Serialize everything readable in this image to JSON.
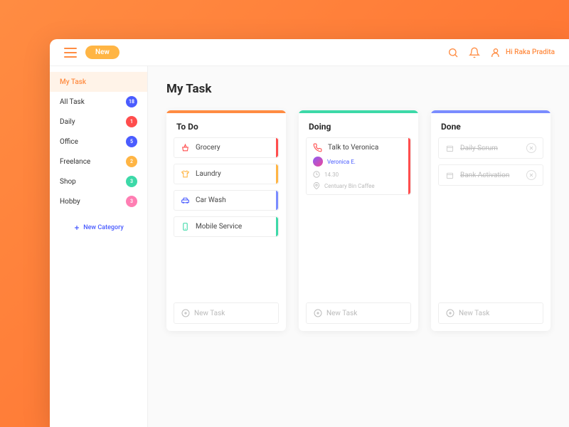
{
  "topbar": {
    "newLabel": "New",
    "greeting": "Hi Raka Pradita"
  },
  "sidebar": {
    "items": [
      {
        "label": "My Task",
        "active": true
      },
      {
        "label": "All Task",
        "badge": "18",
        "color": "#4a5cff"
      },
      {
        "label": "Daily",
        "badge": "1",
        "color": "#ff4d4d"
      },
      {
        "label": "Office",
        "badge": "5",
        "color": "#4a5cff"
      },
      {
        "label": "Freelance",
        "badge": "2",
        "color": "#ffb544"
      },
      {
        "label": "Shop",
        "badge": "3",
        "color": "#3dd9a8"
      },
      {
        "label": "Hobby",
        "badge": "3",
        "color": "#ff7eb3"
      }
    ],
    "newCategory": "New Category"
  },
  "page": {
    "title": "My Task"
  },
  "columns": {
    "todo": {
      "title": "To Do",
      "barColor": "#ff8c42",
      "tasks": [
        {
          "label": "Grocery",
          "iconColor": "#ff4d4d",
          "stripe": "#ff4d4d"
        },
        {
          "label": "Laundry",
          "iconColor": "#ffb544",
          "stripe": "#ffb544"
        },
        {
          "label": "Car Wash",
          "iconColor": "#4a5cff",
          "stripe": "#7a8cff"
        },
        {
          "label": "Mobile Service",
          "iconColor": "#3dd9a8",
          "stripe": "#3dd9a8"
        }
      ],
      "newTask": "New Task"
    },
    "doing": {
      "title": "Doing",
      "barColor": "#3dd9a8",
      "task": {
        "label": "Talk to Veronica",
        "iconColor": "#ff4d4d",
        "stripe": "#ff4d4d",
        "person": "Veronica E.",
        "time": "14.30",
        "place": "Centuary Bin Caffee"
      },
      "newTask": "New Task"
    },
    "done": {
      "title": "Done",
      "barColor": "#7a8cff",
      "tasks": [
        {
          "label": "Daily Scrum"
        },
        {
          "label": "Bank Activation"
        }
      ],
      "newTask": "New Task"
    }
  }
}
